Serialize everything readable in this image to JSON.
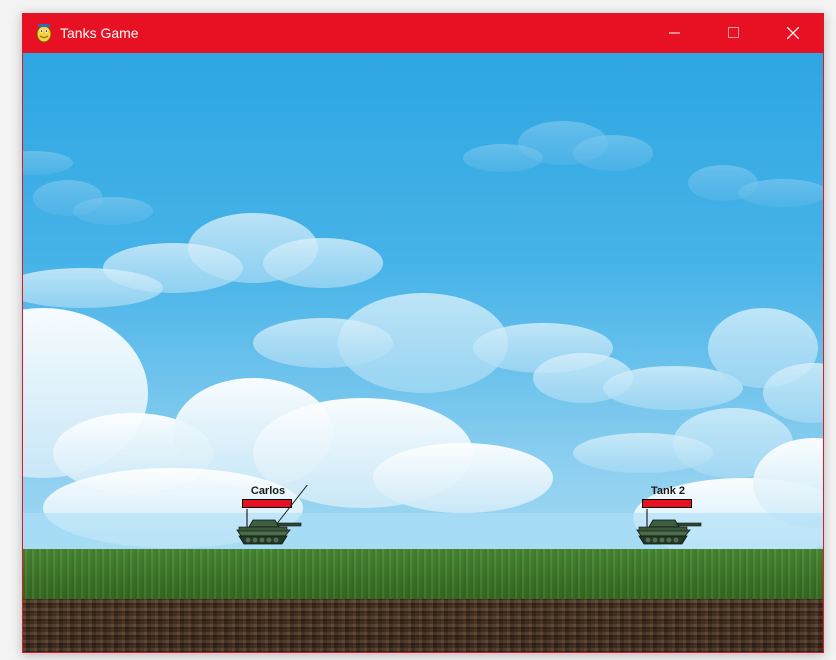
{
  "window": {
    "title": "Tanks Game",
    "accent_color": "#e81123",
    "controls": [
      "minimize-icon",
      "maximize-icon",
      "close-icon"
    ]
  },
  "game": {
    "sky_color": "#3aa8e0",
    "grass_color": "#3f7a2a",
    "dirt_color": "#3e2c1e",
    "players": [
      {
        "name": "Carlos",
        "health_fraction": 1.0,
        "health_color": "#e81123"
      },
      {
        "name": "Tank 2",
        "health_fraction": 1.0,
        "health_color": "#e81123"
      }
    ]
  }
}
